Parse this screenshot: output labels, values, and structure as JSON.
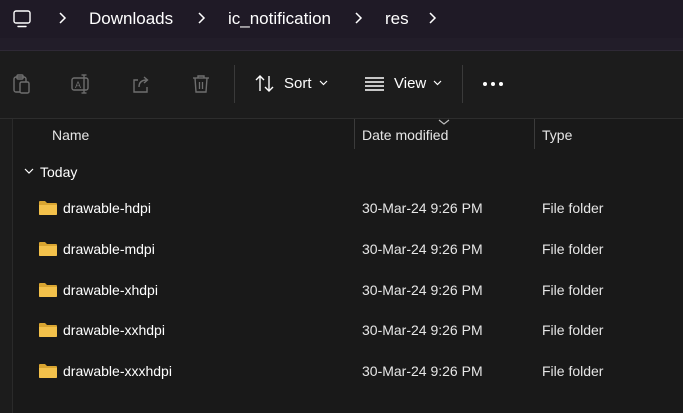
{
  "breadcrumb": {
    "root_icon": "computer-icon",
    "items": [
      "Downloads",
      "ic_notification",
      "res"
    ]
  },
  "toolbar": {
    "icons": [
      "paste-icon",
      "rename-icon",
      "share-icon",
      "delete-icon"
    ],
    "sort_label": "Sort",
    "view_label": "View",
    "more_icon": "more-dots-icon"
  },
  "columns": {
    "name": "Name",
    "date_modified": "Date modified",
    "type": "Type"
  },
  "group": {
    "label": "Today"
  },
  "files": [
    {
      "name": "drawable-hdpi",
      "date": "30-Mar-24 9:26 PM",
      "type": "File folder"
    },
    {
      "name": "drawable-mdpi",
      "date": "30-Mar-24 9:26 PM",
      "type": "File folder"
    },
    {
      "name": "drawable-xhdpi",
      "date": "30-Mar-24 9:26 PM",
      "type": "File folder"
    },
    {
      "name": "drawable-xxhdpi",
      "date": "30-Mar-24 9:26 PM",
      "type": "File folder"
    },
    {
      "name": "drawable-xxxhdpi",
      "date": "30-Mar-24 9:26 PM",
      "type": "File folder"
    }
  ],
  "colors": {
    "folder": "#f3c14b",
    "folder_dark": "#d9a531",
    "disabled_icon": "#6e6e6e"
  }
}
